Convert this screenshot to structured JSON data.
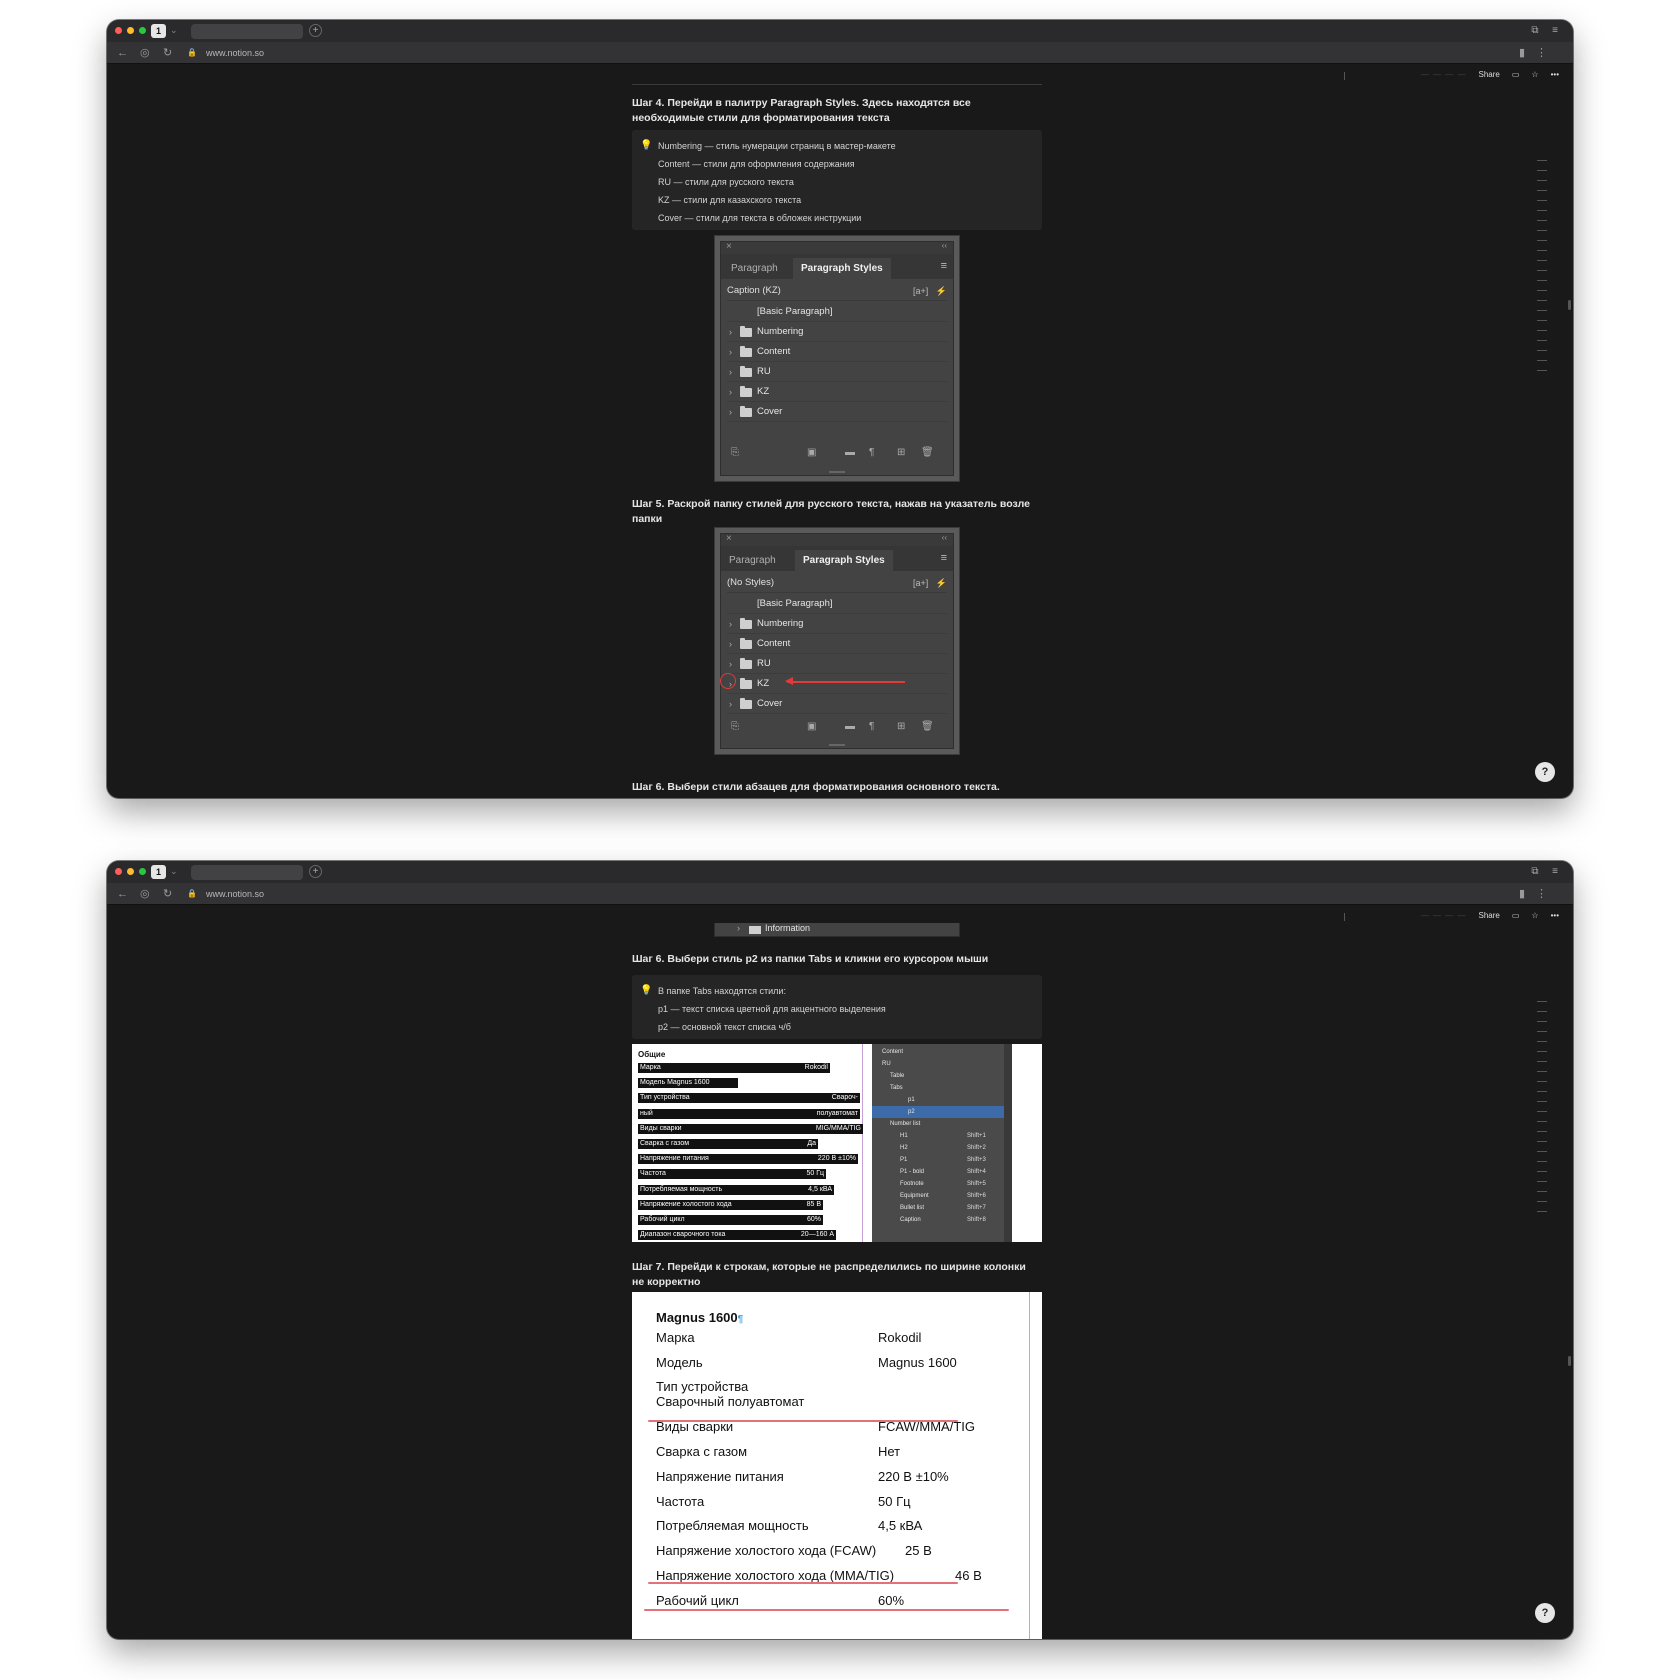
{
  "browser": {
    "url": "www.notion.so",
    "tab_count": "1",
    "share_label": "Share",
    "dashes": "— — — —"
  },
  "steps": {
    "step4": "Шаг 4. Перейди в палитру Paragraph Styles. Здесь находятся все необходимые стили для форматирования текста",
    "step5": "Шаг 5. Раскрой папку стилей для русского текста, нажав на указатель возле папки",
    "step6a": "Шаг 6. Выбери стили абзацев для форматирования основного текста.",
    "step6b": "Шаг 6. Выбери стиль p2 из папки Tabs и кликни его курсором мыши",
    "step7": "Шаг 7. Перейди к строкам, которые не распределились по ширине колонки не корректно"
  },
  "callout1": [
    "Numbering — стиль нумерации страниц в мастер-макете",
    "Content — стили для оформления содержания",
    "RU — стили для русского текста",
    "KZ — стили для казахского текста",
    "Cover — стили для текста в обложек инструкции"
  ],
  "callout2": [
    "В папке Tabs находятся стили:",
    "p1 — текст списка цветной для акцентного выделения",
    "p2 — основной текст списка ч/б"
  ],
  "panel1": {
    "tab_inactive": "Paragraph",
    "tab_active": "Paragraph Styles",
    "header": "Caption (KZ)",
    "header_right": "[a+]",
    "basic": "[Basic Paragraph]",
    "folders": [
      "Numbering",
      "Content",
      "RU",
      "KZ",
      "Cover"
    ]
  },
  "panel2": {
    "tab_inactive": "Paragraph",
    "tab_active": "Paragraph Styles",
    "header": "(No Styles)",
    "header_right": "[a+]",
    "basic": "[Basic Paragraph]",
    "folders": [
      "Numbering",
      "Content",
      "RU",
      "KZ",
      "Cover"
    ]
  },
  "info_strip": "Information",
  "shot1": {
    "title": "Общие",
    "rows": [
      {
        "k": "Марка",
        "v": "Rokodil"
      },
      {
        "k": "Модель Magnus 1600",
        "v": ""
      },
      {
        "k": "Тип устройства",
        "v": "Свароч-"
      },
      {
        "k": "ный",
        "v": "полуавтомат"
      },
      {
        "k": "Виды сварки",
        "v": "MIG/MMA/TIG"
      },
      {
        "k": "Сварка с газом",
        "v": "Да"
      },
      {
        "k": "Напряжение питания",
        "v": "220 В ±10%"
      },
      {
        "k": "Частота",
        "v": "50 Гц"
      },
      {
        "k": "Потребляемая мощность",
        "v": "4,5 кВА"
      },
      {
        "k": "Напряжение холостого хода",
        "v": "85 В"
      },
      {
        "k": "Рабочий цикл",
        "v": "60%"
      },
      {
        "k": "Диапазон сварочного тока",
        "v": "20—160 А"
      }
    ],
    "styles": [
      {
        "name": "Content"
      },
      {
        "name": "RU"
      },
      {
        "name": "Table"
      },
      {
        "name": "Tabs"
      },
      {
        "name": "p1"
      },
      {
        "name": "p2"
      },
      {
        "name": "Number list"
      },
      {
        "name": "H1",
        "sc": "Shift+1"
      },
      {
        "name": "H2",
        "sc": "Shift+2"
      },
      {
        "name": "P1",
        "sc": "Shift+3"
      },
      {
        "name": "P1 - bold",
        "sc": "Shift+4"
      },
      {
        "name": "Footnote",
        "sc": "Shift+5"
      },
      {
        "name": "Equipment",
        "sc": "Shift+6"
      },
      {
        "name": "Bullet list",
        "sc": "Shift+7"
      },
      {
        "name": "Caption",
        "sc": "Shift+8"
      }
    ]
  },
  "shot2": {
    "title": "Magnus 1600",
    "rows": [
      {
        "k": "Марка",
        "v": "Rokodil"
      },
      {
        "k": "Модель",
        "v": "Magnus 1600"
      },
      {
        "k": "Тип устройства",
        "v": ""
      },
      {
        "k": "Сварочный полуавтомат",
        "v": ""
      },
      {
        "k": "Виды сварки",
        "v": "FCAW/MMA/TIG"
      },
      {
        "k": "Сварка с газом",
        "v": "Нет"
      },
      {
        "k": "Напряжение питания",
        "v": "220 В ±10%"
      },
      {
        "k": "Частота",
        "v": "50 Гц"
      },
      {
        "k": "Потребляемая мощность",
        "v": "4,5 кВА"
      },
      {
        "k": "Напряжение холостого хода (FCAW)",
        "v": "25 В"
      },
      {
        "k": "Напряжение холостого хода (MMA/TIG)",
        "v": "46 В"
      },
      {
        "k": "Рабочий цикл",
        "v": "60%"
      }
    ]
  },
  "colors": {
    "red_mark": "#e23a3a",
    "selection": "#3d6aa8"
  }
}
